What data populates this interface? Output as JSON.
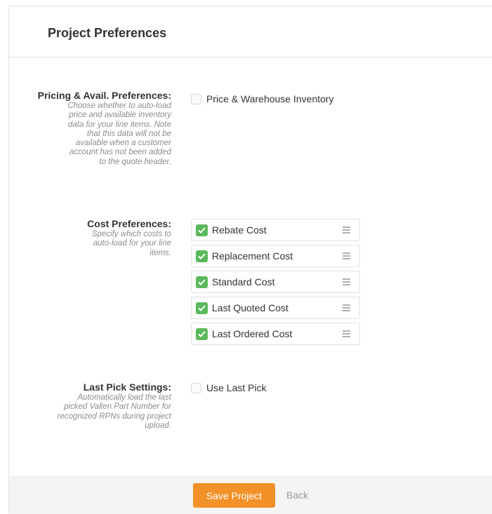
{
  "header": {
    "title": "Project Preferences"
  },
  "pricing": {
    "title": "Pricing & Avail. Preferences:",
    "description": "Choose whether to auto-load price and available inventory data for your line items. Note that this data will not be available when a customer account has not been added to the quote header.",
    "option_label": "Price & Warehouse Inventory",
    "checked": false
  },
  "cost": {
    "title": "Cost Preferences:",
    "description": "Specify which costs to auto-load for your line items.",
    "items": [
      {
        "label": "Rebate Cost",
        "checked": true
      },
      {
        "label": "Replacement Cost",
        "checked": true
      },
      {
        "label": "Standard Cost",
        "checked": true
      },
      {
        "label": "Last Quoted Cost",
        "checked": true
      },
      {
        "label": "Last Ordered Cost",
        "checked": true
      }
    ]
  },
  "last_pick": {
    "title": "Last Pick Settings:",
    "description": "Automatically load the last picked Vallen Part Number for recognized RPNs during project upload.",
    "option_label": "Use Last Pick",
    "checked": false
  },
  "footer": {
    "save_label": "Save Project",
    "back_label": "Back"
  },
  "colors": {
    "accent": "#f29128",
    "check_green": "#5cb85c",
    "footer_bg": "#f4f4f4"
  }
}
